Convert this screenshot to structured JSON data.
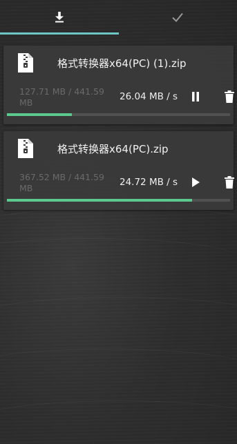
{
  "tabs": [
    {
      "icon": "download-icon",
      "active": true
    },
    {
      "icon": "check-icon",
      "active": false
    }
  ],
  "downloads": [
    {
      "filename": "格式转换器x64(PC) (1).zip",
      "progress_text": "127.71 MB / 441.59 MB",
      "speed": "26.04 MB / s",
      "state_icon": "pause-icon",
      "progress": 0.29
    },
    {
      "filename": "格式转换器x64(PC).zip",
      "progress_text": "367.52 MB / 441.59 MB",
      "speed": "24.72 MB / s",
      "state_icon": "play-icon",
      "progress": 0.83
    }
  ],
  "colors": {
    "accent": "#6fc7c4",
    "progress": "#5cc98f"
  }
}
